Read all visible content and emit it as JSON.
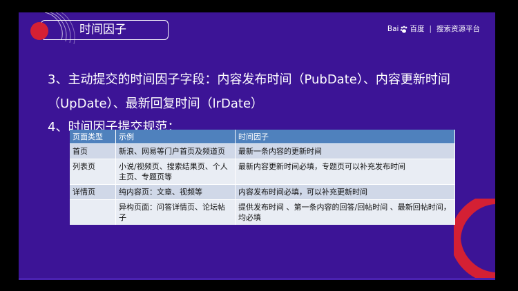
{
  "slide": {
    "title": "时间因子",
    "logo": {
      "brand": "Bai",
      "brand_cn": "百度",
      "divider": "|",
      "product": "搜索资源平台"
    }
  },
  "content": {
    "line1": "3、主动提交的时间因子字段：内容发布时间（PubDate）、内容更新时间",
    "line2": "（UpDate）、最新回复时间（lrDate）",
    "line3": "4、时间因子提交规范："
  },
  "table": {
    "headers": [
      "页面类型",
      "示例",
      "时间因子"
    ],
    "rows": [
      [
        "首页",
        "新浪、网易等门户首页及频道页",
        "最新一条内容的更新时间"
      ],
      [
        "列表页",
        "小说/视频页、搜索结果页、个人主页、专题页等",
        "最新内容更新时间必填，专题页可以补充发布时间"
      ],
      [
        "详情页",
        "纯内容页：文章、视频等",
        "内容发布时间必填，可以补充更新时间"
      ],
      [
        "",
        "异构页面：问答详情页、论坛帖子",
        "提供发布时间 、第一条内容的回答/回帖时间 、最新回帖时间，均必填"
      ]
    ]
  },
  "colors": {
    "background": "#3c1496",
    "accent_red": "#d42034",
    "table_header": "#4f81bd",
    "row_odd": "#d0d8e8",
    "row_even": "#e9edf4"
  }
}
